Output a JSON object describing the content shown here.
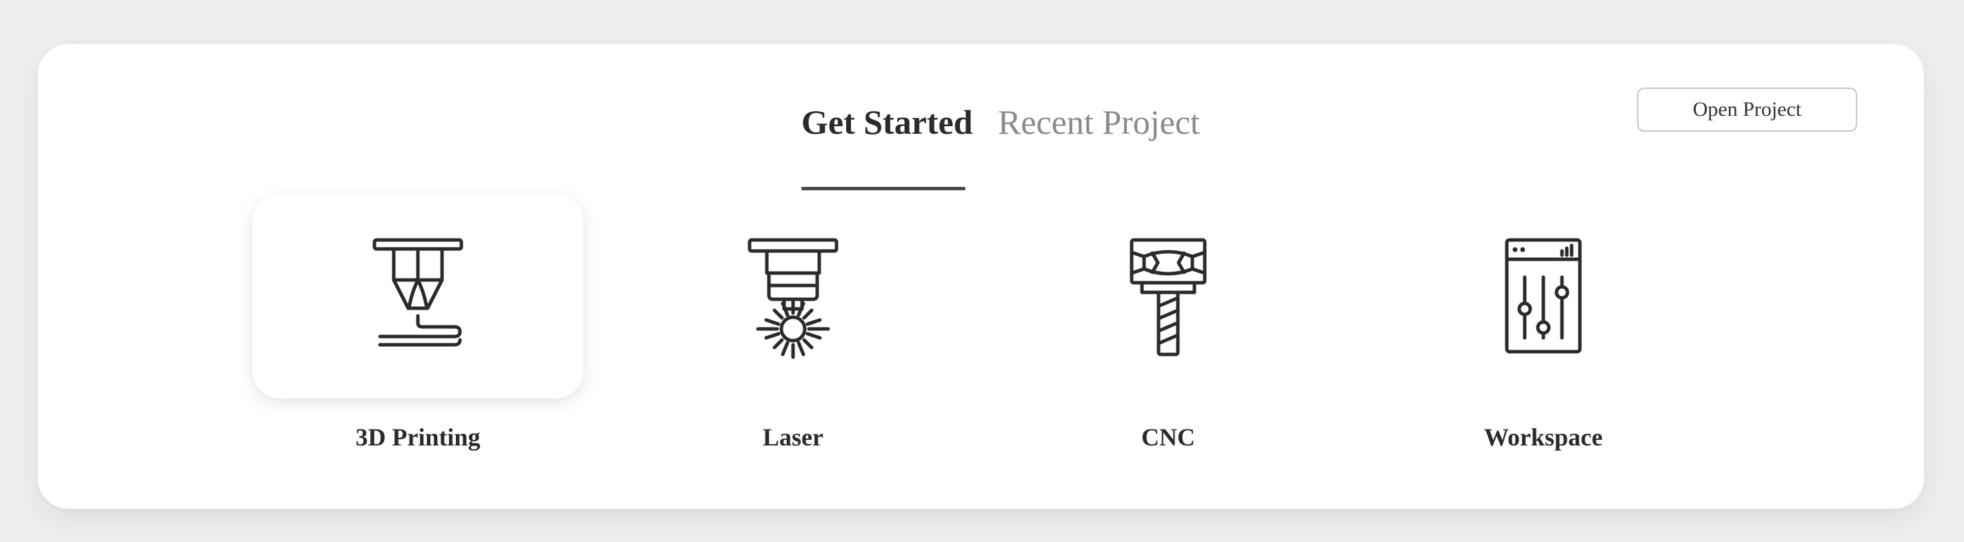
{
  "tabs": {
    "get_started": "Get Started",
    "recent_project": "Recent Project",
    "active": "get_started"
  },
  "open_project_label": "Open Project",
  "cards": [
    {
      "label": "3D Printing",
      "icon": "3d-printer-nozzle-icon",
      "selected": true
    },
    {
      "label": "Laser",
      "icon": "laser-head-icon",
      "selected": false
    },
    {
      "label": "CNC",
      "icon": "cnc-spindle-icon",
      "selected": false
    },
    {
      "label": "Workspace",
      "icon": "workspace-sliders-icon",
      "selected": false
    }
  ],
  "colors": {
    "background": "#eeeef0",
    "panel": "#ffffff",
    "text_primary": "#2b2b2b",
    "text_muted": "#8a8a8a",
    "underline": "#4a4a4a",
    "button_border": "#c8c8cc"
  }
}
